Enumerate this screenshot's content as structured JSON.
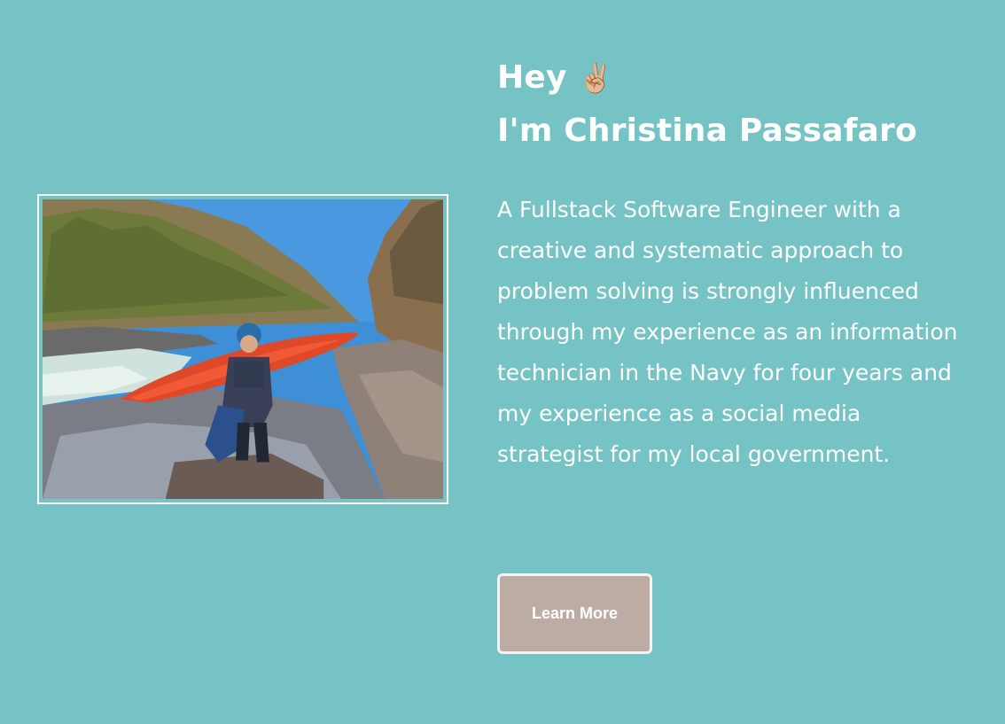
{
  "hero": {
    "greeting_word": "Hey",
    "greeting_emoji": "✌🏼",
    "name_line": "I'm Christina Passafaro",
    "bio": "A Fullstack Software Engineer with a creative and systematic approach to problem solving is strongly influenced through my experience as an information technician in the Navy for four years and my experience as a social media strategist for my local government.",
    "button_label": "Learn More",
    "photo_icon": "kayaker-photo"
  },
  "colors": {
    "background": "#75c3c4",
    "text": "#ffffff",
    "button_bg": "#bcaca3",
    "button_border": "#f4f4f4"
  }
}
